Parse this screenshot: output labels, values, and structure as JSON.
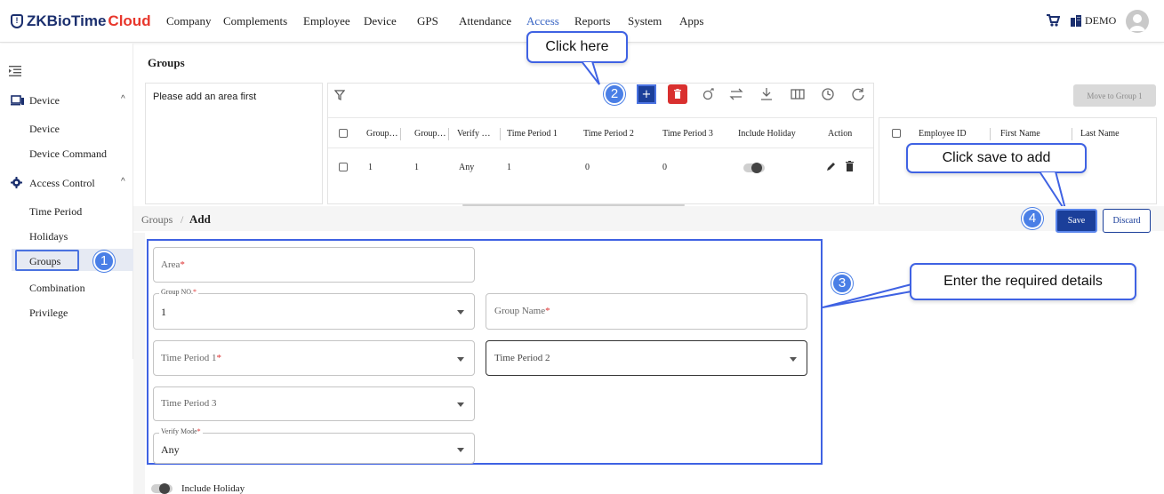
{
  "app": {
    "logo_prefix": "ZKBioTime",
    "logo_suffix": "Cloud"
  },
  "topnav": {
    "items": [
      "Company",
      "Complements",
      "Employee",
      "Device",
      "GPS",
      "Attendance",
      "Access",
      "Reports",
      "System",
      "Apps"
    ],
    "active": "Access",
    "user": "DEMO"
  },
  "sidebar": {
    "device_header": "Device",
    "device_items": [
      "Device",
      "Device Command"
    ],
    "access_header": "Access Control",
    "access_items": [
      "Time Period",
      "Holidays",
      "Groups",
      "Combination",
      "Privilege"
    ],
    "selected": "Groups"
  },
  "page": {
    "title": "Groups",
    "area_placeholder": "Please add an area first",
    "move_button": "Move to Group 1"
  },
  "table": {
    "headers": [
      "Group…",
      "Group…",
      "Verify …",
      "Time Period 1",
      "Time Period 2",
      "Time Period 3",
      "Include Holiday",
      "Action"
    ],
    "row": [
      "1",
      "1",
      "Any",
      "1",
      "0",
      "0"
    ]
  },
  "employee_table": {
    "headers": [
      "Employee ID",
      "First Name",
      "Last Name"
    ]
  },
  "form": {
    "breadcrumb_parent": "Groups",
    "breadcrumb_sep": "/",
    "breadcrumb_current": "Add",
    "save": "Save",
    "discard": "Discard",
    "area_label": "Area",
    "group_no_label": "Group NO.",
    "group_no_value": "1",
    "group_name_label": "Group Name",
    "tp1_label": "Time Period 1",
    "tp2_label": "Time Period 2",
    "tp3_label": "Time Period 3",
    "verify_label": "Verify Mode",
    "verify_value": "Any",
    "include_holiday": "Include Holiday",
    "required_mark": "*"
  },
  "annotations": {
    "badge1": "1",
    "badge2": "2",
    "badge3": "3",
    "badge4": "4",
    "click_here": "Click here",
    "click_save": "Click save to add",
    "enter_details": "Enter the required details"
  },
  "colors": {
    "brand_dark": "#1b2f6e",
    "brand_red": "#e8372c",
    "primary_button": "#1b3f9a",
    "delete_button": "#d9302f",
    "annotation_blue": "#3f62e3"
  }
}
